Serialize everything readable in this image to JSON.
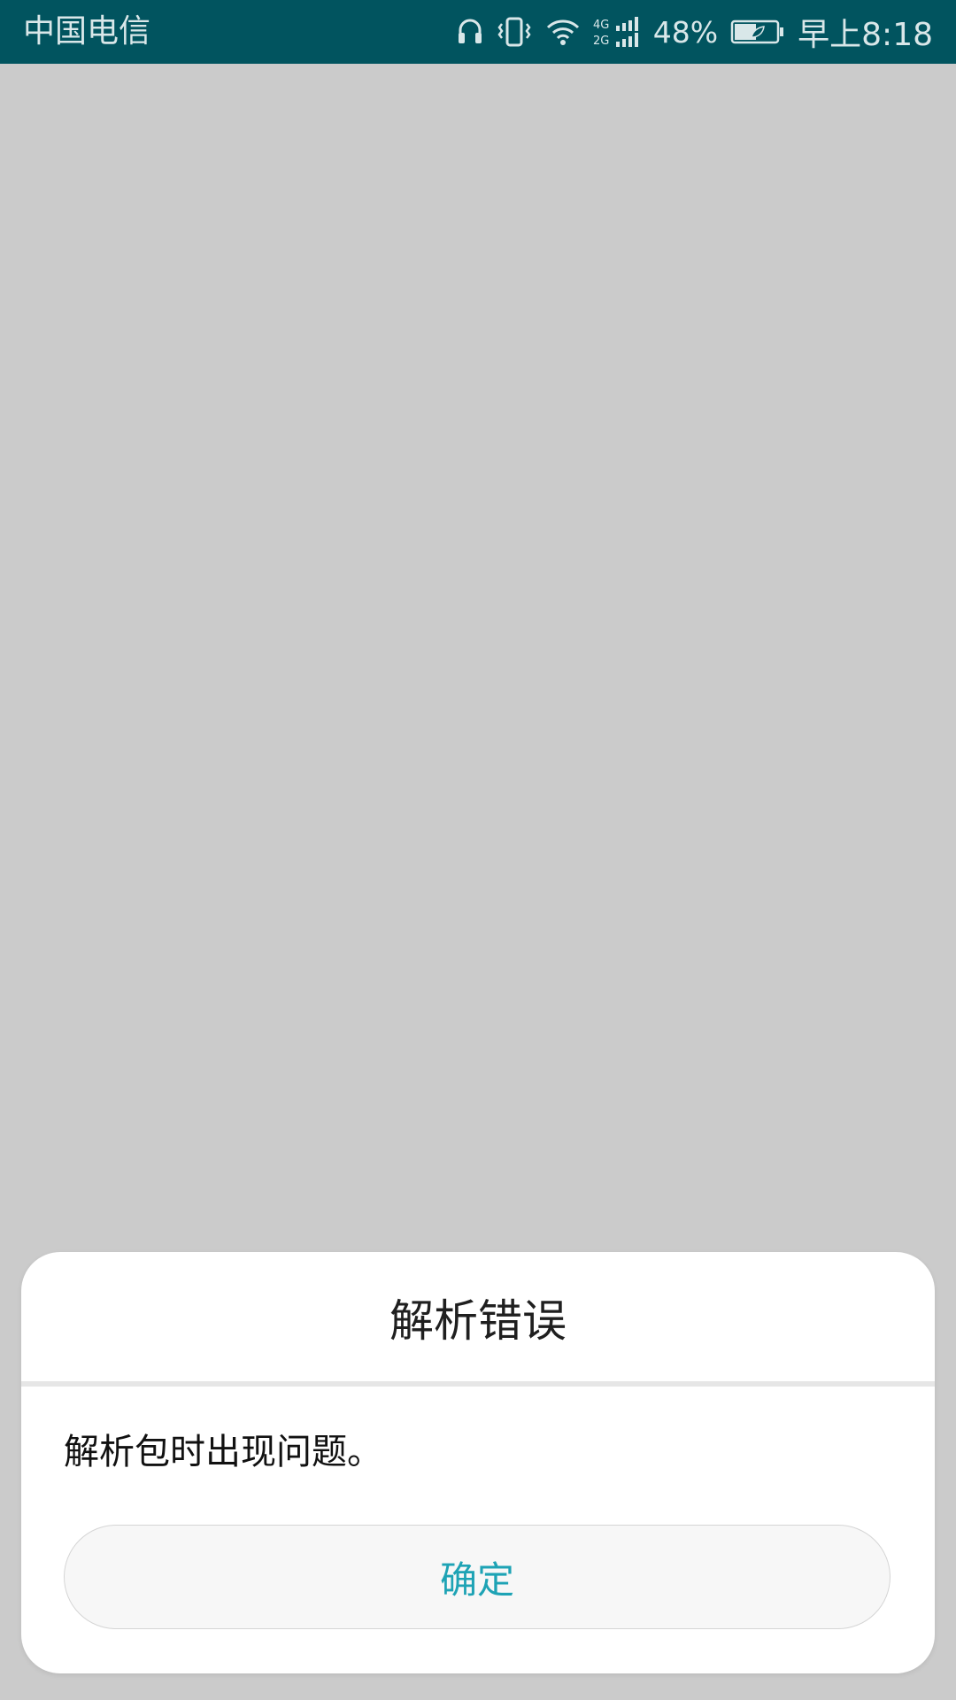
{
  "status_bar": {
    "carrier": "中国电信",
    "network_label_top": "4G",
    "network_label_bottom": "2G",
    "battery_percent": "48%",
    "time": "早上8:18",
    "icons": [
      "headset-icon",
      "vibrate-icon",
      "wifi-icon",
      "signal-icon",
      "battery-icon"
    ]
  },
  "dialog": {
    "title": "解析错误",
    "message": "解析包时出现问题。",
    "ok_label": "确定"
  },
  "colors": {
    "status_bar_bg": "#01545f",
    "accent": "#1ea3b5",
    "backdrop": "#cbcbcb"
  }
}
